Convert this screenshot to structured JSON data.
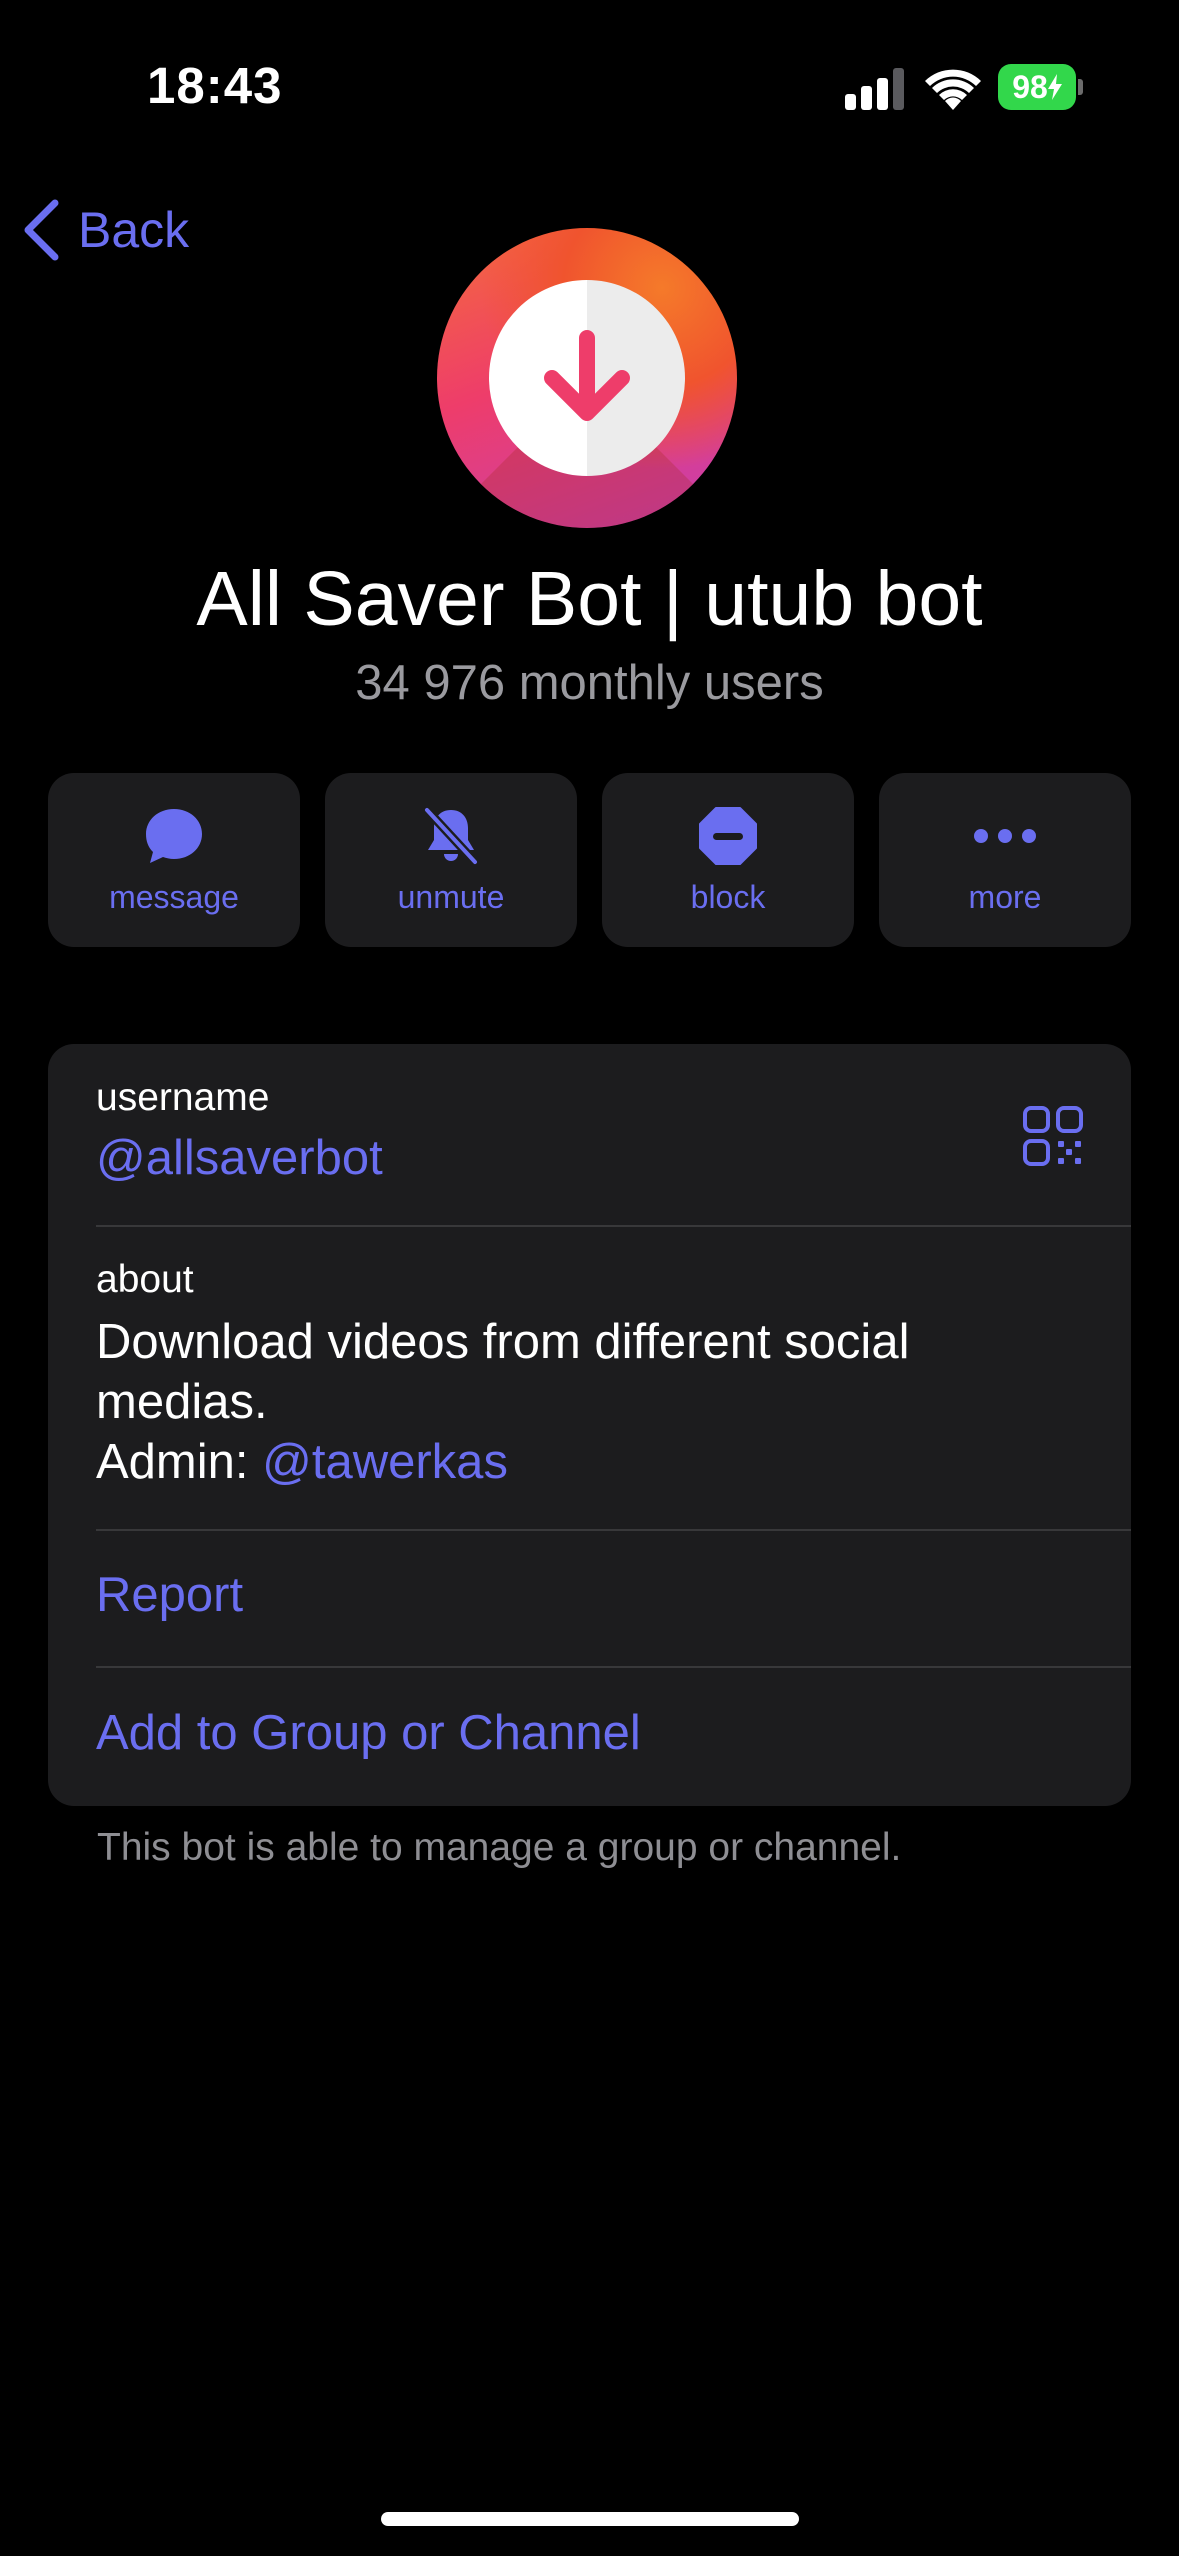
{
  "status_bar": {
    "time": "18:43",
    "battery": "98"
  },
  "nav": {
    "back_label": "Back"
  },
  "profile": {
    "name": "All Saver Bot | utub bot",
    "subtitle": "34 976 monthly users"
  },
  "actions": [
    {
      "label": "message",
      "icon": "chat-bubble-icon"
    },
    {
      "label": "unmute",
      "icon": "bell-slash-icon"
    },
    {
      "label": "block",
      "icon": "block-icon"
    },
    {
      "label": "more",
      "icon": "ellipsis-icon"
    }
  ],
  "info": {
    "username_label": "username",
    "username_value": "@allsaverbot",
    "about_label": "about",
    "about_line1": "Download videos from different social medias.",
    "about_admin_prefix": "Admin: ",
    "about_admin_handle": "@tawerkas",
    "report_label": "Report",
    "add_label": "Add to Group or Channel"
  },
  "footer": {
    "note": "This bot is able to manage a group or channel."
  },
  "colors": {
    "accent": "#6a6ef0",
    "card": "#1c1c1e",
    "battery": "#32d74b"
  }
}
